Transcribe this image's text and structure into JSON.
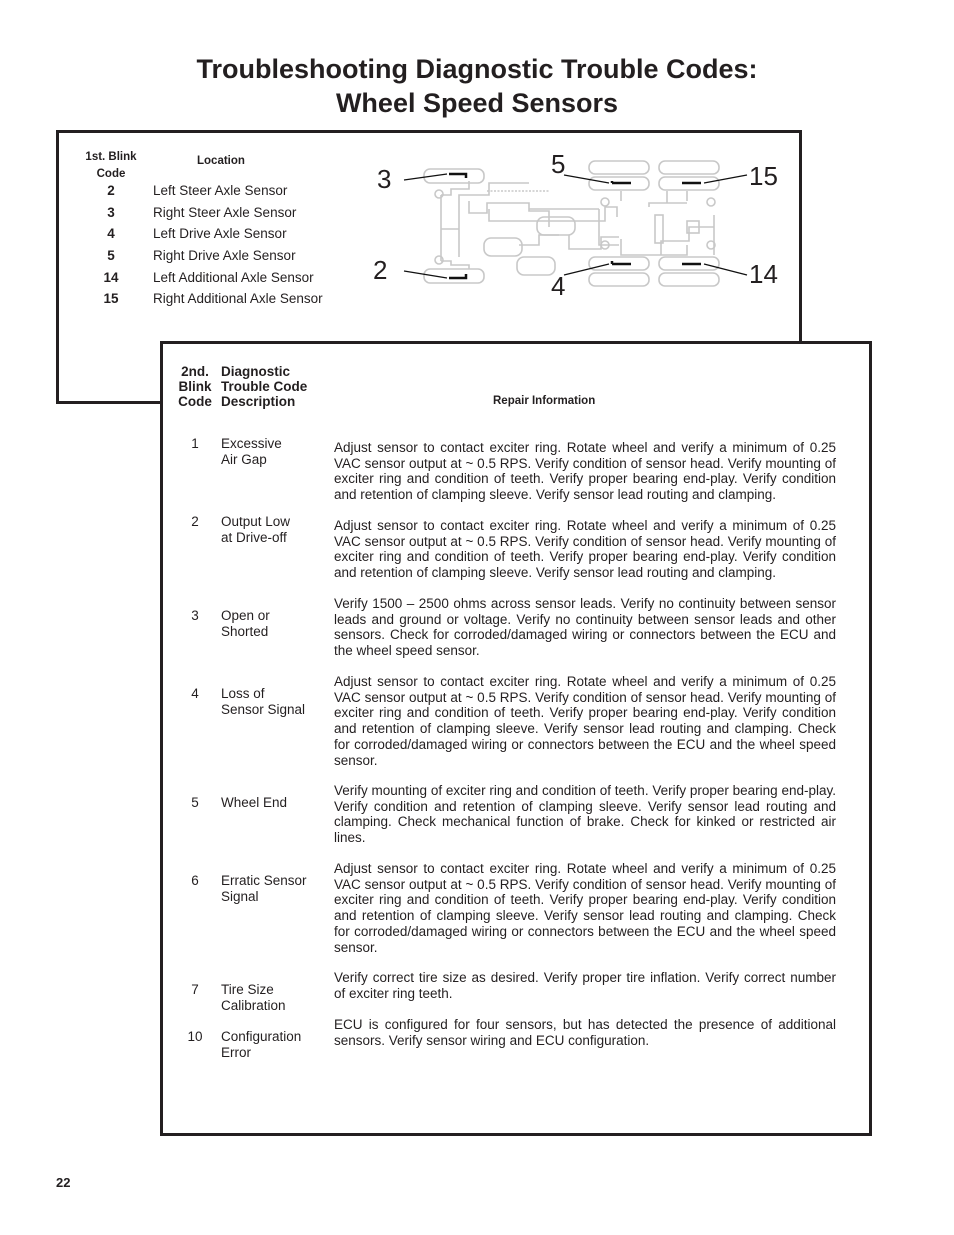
{
  "title": {
    "line1": "Troubleshooting Diagnostic Trouble Codes:",
    "line2": "Wheel Speed Sensors"
  },
  "first_blink": {
    "header_code_line1": "1st. Blink",
    "header_code_line2": "Code",
    "header_location": "Location",
    "rows": [
      {
        "code": "2",
        "location": "Left Steer Axle Sensor"
      },
      {
        "code": "3",
        "location": "Right Steer Axle Sensor"
      },
      {
        "code": "4",
        "location": "Left Drive Axle Sensor"
      },
      {
        "code": "5",
        "location": "Right Drive Axle Sensor"
      },
      {
        "code": "14",
        "location": "Left Additional Axle Sensor"
      },
      {
        "code": "15",
        "location": "Right Additional Axle Sensor"
      }
    ],
    "diagram_labels": {
      "steer_right": "3",
      "steer_left": "2",
      "drive_right": "5",
      "drive_left": "4",
      "additional_right": "15",
      "additional_left": "14"
    }
  },
  "second_blink": {
    "header_code": [
      "2nd.",
      "Blink",
      "Code"
    ],
    "header_desc": [
      "Diagnostic",
      "Trouble Code",
      "Description"
    ],
    "header_repair": "Repair Information",
    "rows": [
      {
        "code": "1",
        "desc": [
          "Excessive",
          "Air Gap"
        ],
        "repair": "Adjust sensor to contact exciter ring. Rotate wheel and verify a minimum of 0.25 VAC sensor output at ~ 0.5 RPS. Verify condition of sensor head. Verify mounting of exciter ring and condition of teeth. Verify proper bearing end-play. Verify condition and retention of clamping sleeve. Verify sensor lead routing and clamping."
      },
      {
        "code": "2",
        "desc": [
          "Output Low",
          "at Drive-off"
        ],
        "repair": "Adjust sensor to contact exciter ring.  Rotate wheel and verify a minimum of 0.25 VAC sensor output at ~ 0.5 RPS.  Verify condition of sensor head.  Verify mounting of exciter ring and condition of teeth. Verify proper bearing end-play.  Verify condition and retention of clamping sleeve.  Verify sensor lead routing and clamping."
      },
      {
        "code": "3",
        "desc": [
          "Open or",
          "Shorted"
        ],
        "repair": "Verify 1500 – 2500 ohms across sensor leads.  Verify no continuity between sensor leads and ground or voltage. Verify no continuity between sensor leads and other sensors.  Check for corroded/damaged wiring or connectors between the ECU and the wheel speed sensor."
      },
      {
        "code": "4",
        "desc": [
          "Loss of",
          "Sensor Signal"
        ],
        "repair": "Adjust sensor to contact exciter ring.  Rotate wheel and verify a minimum of 0.25 VAC sensor output at ~ 0.5 RPS.  Verify condition of sensor head.  Verify mounting of exciter ring and condition of teeth. Verify proper bearing end-play. Verify condition and retention of clamping sleeve.  Verify sensor lead routing and clamping.  Check for corroded/damaged wiring or connectors between the ECU and the wheel speed sensor."
      },
      {
        "code": "5",
        "desc": [
          "Wheel End",
          ""
        ],
        "repair": "Verify mounting of exciter ring and condition of teeth. Verify proper bearing end-play.  Verify condition and retention of clamping sleeve.  Verify sensor lead routing and clamping.  Check mechanical function of brake. Check for kinked or restricted air lines."
      },
      {
        "code": "6",
        "desc": [
          "Erratic Sensor",
          "Signal"
        ],
        "repair": "Adjust sensor to contact exciter ring.  Rotate wheel and verify a minimum of 0.25 VAC sensor output at ~ 0.5 RPS. Verify condition of sensor head.  Verify mounting of exciter ring and condition of teeth. Verify proper bearing end-play. Verify condition and retention of clamping sleeve.  Verify sensor lead routing and clamping.  Check for corroded/damaged wiring or connectors between the ECU and the wheel speed sensor."
      },
      {
        "code": "7",
        "desc": [
          "Tire Size",
          "Calibration"
        ],
        "repair": "Verify correct tire size as desired.  Verify proper tire inflation.  Verify correct number of exciter ring teeth."
      },
      {
        "code": "10",
        "desc": [
          "Configuration",
          "Error"
        ],
        "repair": "ECU is configured for four sensors, but has detected the presence of additional sensors.  Verify sensor wiring and ECU configuration."
      }
    ]
  },
  "page_number": "22"
}
